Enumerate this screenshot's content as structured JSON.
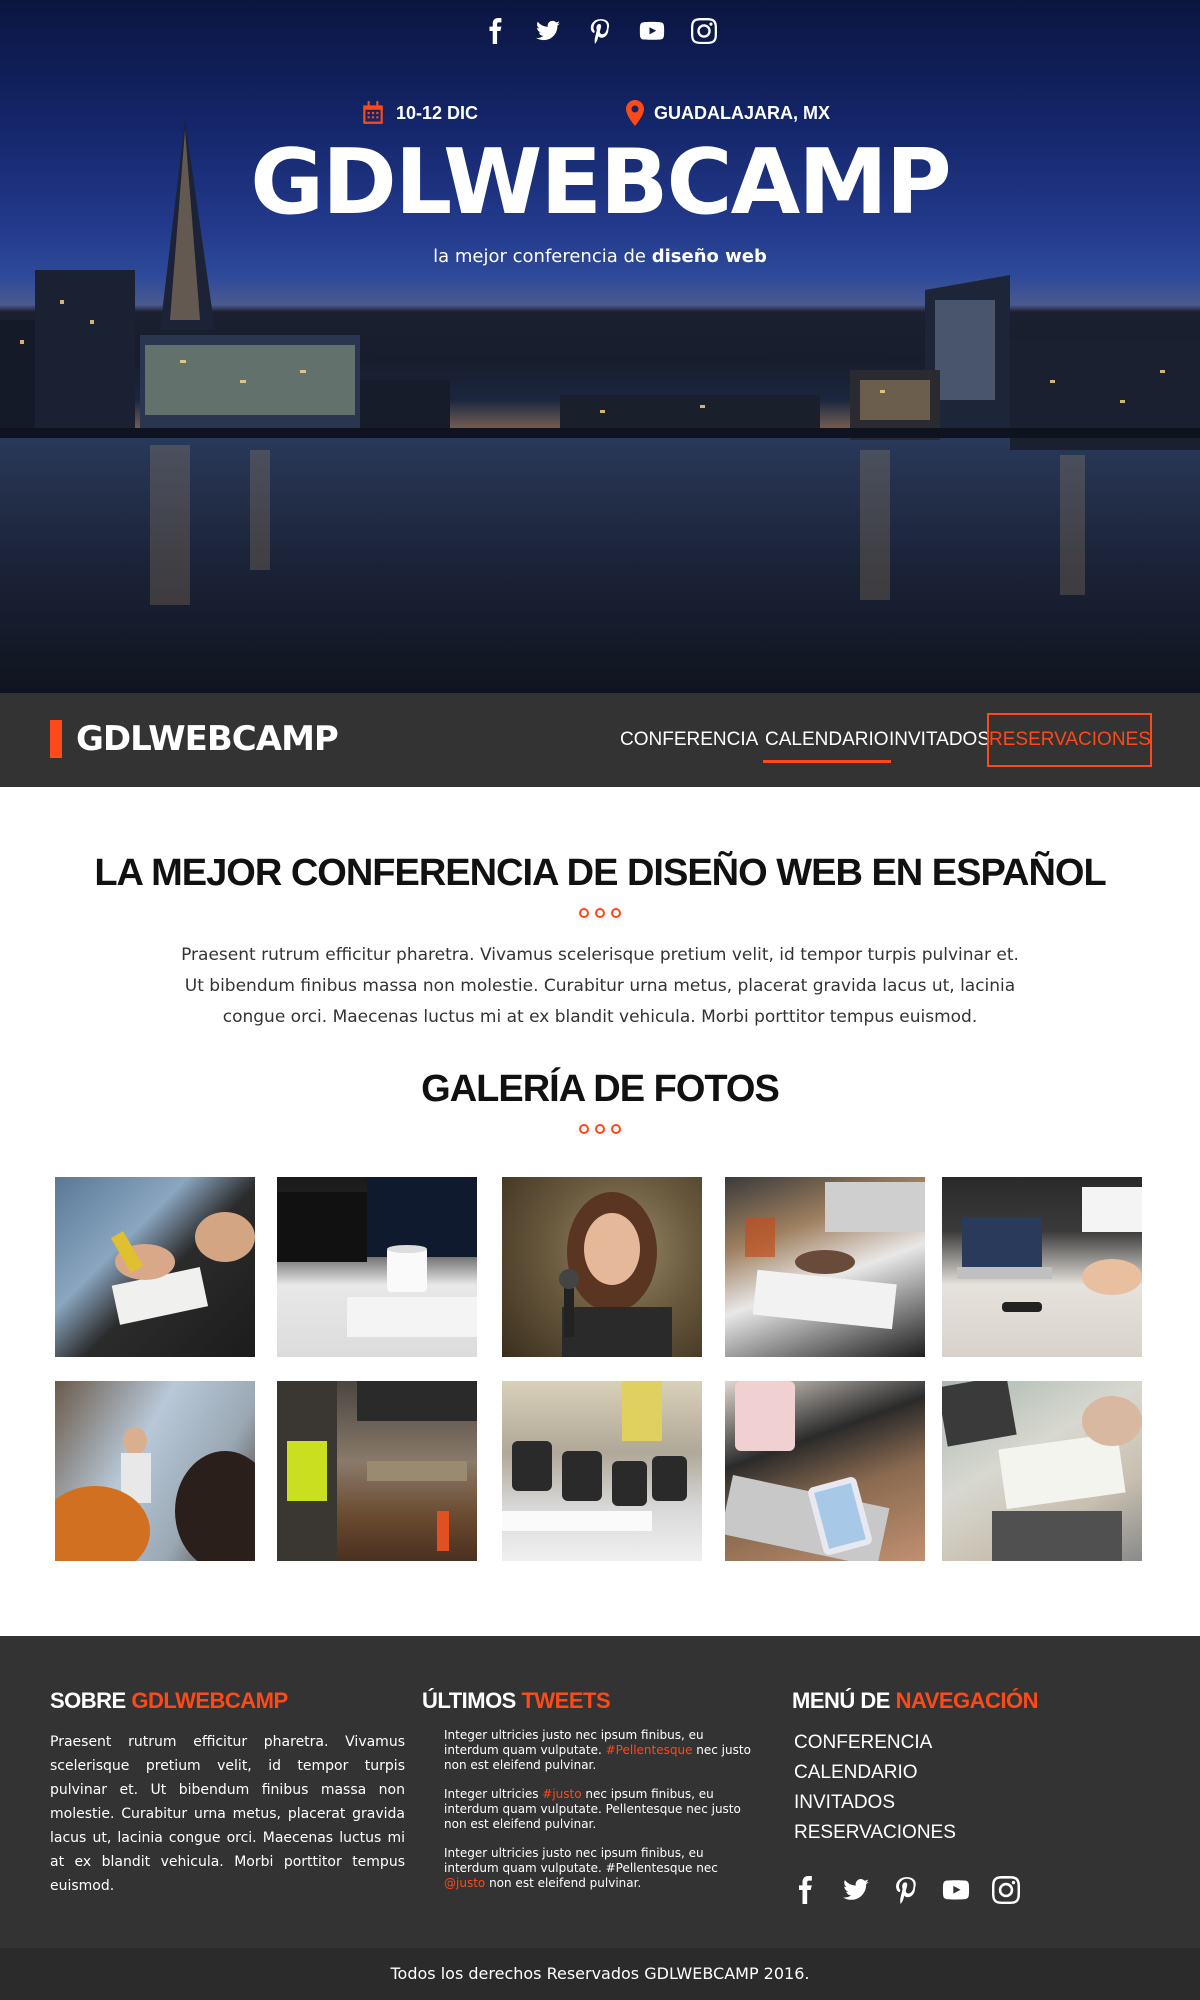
{
  "hero": {
    "social": [
      "facebook-icon",
      "twitter-icon",
      "pinterest-icon",
      "youtube-icon",
      "instagram-icon"
    ],
    "date": "10-12 DIC",
    "place": "GUADALAJARA, MX",
    "title": "GDLWEBCAMP",
    "slogan_prefix": "la mejor conferencia de ",
    "slogan_bold": "diseño web"
  },
  "nav": {
    "brand": "GDLWEBCAMP",
    "links": [
      "CONFERENCIA",
      "CALENDARIO",
      "INVITADOS",
      "RESERVACIONES"
    ],
    "active": "CALENDARIO"
  },
  "intro": {
    "title": "LA MEJOR CONFERENCIA DE DISEÑO WEB EN ESPAÑOL",
    "text": "Praesent rutrum efficitur pharetra. Vivamus scelerisque pretium velit, id tempor turpis pulvinar et. Ut bibendum finibus massa non molestie. Curabitur urna metus, placerat gravida lacus ut, lacinia congue orci. Maecenas luctus mi at ex blandit vehicula. Morbi porttitor tempus euismod."
  },
  "gallery": {
    "title": "GALERÍA DE FOTOS",
    "photos": [
      "photo-writing",
      "photo-desk-mug",
      "photo-speaker",
      "photo-laptop-table",
      "photo-laptops-meeting",
      "photo-presentation",
      "photo-office",
      "photo-chairs",
      "photo-phone-laptop",
      "photo-notes"
    ]
  },
  "footer": {
    "about": {
      "title_plain": "SOBRE ",
      "title_accent": "GDLWEBCAMP",
      "text": "Praesent rutrum efficitur pharetra. Vivamus scelerisque pretium velit, id tempor turpis pulvinar et. Ut bibendum finibus massa non molestie. Curabitur urna metus, placerat gravida lacus ut, lacinia congue orci. Maecenas luctus mi at ex blandit vehicula. Morbi porttitor tempus euismod."
    },
    "tweets": {
      "title_plain": "ÚLTIMOS ",
      "title_accent": "TWEETS",
      "items": [
        {
          "before": "Integer ultricies justo nec ipsum finibus, eu interdum quam vulputate. ",
          "highlight": "#Pellentesque",
          "after": " nec justo non est eleifend pulvinar."
        },
        {
          "before": "Integer ultricies ",
          "highlight": "#justo",
          "after": " nec ipsum finibus, eu interdum quam vulputate. Pellentesque nec justo non est eleifend pulvinar."
        },
        {
          "before": "Integer ultricies justo nec ipsum finibus, eu interdum quam vulputate. #Pellentesque nec ",
          "highlight": "@justo",
          "after": " non est eleifend pulvinar."
        }
      ]
    },
    "menu": {
      "title_plain": "MENÚ DE ",
      "title_accent": "NAVEGACIÓN",
      "links": [
        "CONFERENCIA",
        "CALENDARIO",
        "INVITADOS",
        "RESERVACIONES"
      ]
    },
    "social": [
      "facebook-icon",
      "twitter-icon",
      "pinterest-icon",
      "youtube-icon",
      "instagram-icon"
    ]
  },
  "copyright": "Todos los derechos Reservados GDLWEBCAMP 2016.",
  "colors": {
    "accent": "#fe4918",
    "dark": "#333333"
  }
}
